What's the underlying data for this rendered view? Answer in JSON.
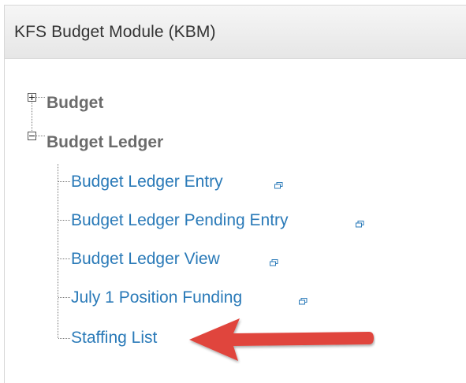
{
  "panel": {
    "title": "KFS Budget Module (KBM)"
  },
  "tree": {
    "folders": [
      {
        "label": "Budget",
        "state": "collapsed",
        "icon": "plus-expander-icon"
      },
      {
        "label": "Budget Ledger",
        "state": "expanded",
        "icon": "minus-expander-icon"
      }
    ],
    "links": [
      {
        "label": "Budget Ledger Entry",
        "external": true
      },
      {
        "label": "Budget Ledger Pending Entry",
        "external": true
      },
      {
        "label": "Budget Ledger View",
        "external": true
      },
      {
        "label": "July 1 Position Funding",
        "external": true
      },
      {
        "label": "Staffing List",
        "external": false
      }
    ]
  },
  "annotation": {
    "icon": "red-arrow-icon",
    "color": "#e0443e",
    "points_to": "Staffing List"
  },
  "colors": {
    "link": "#2a7ab8",
    "folder": "#6b6b6b",
    "header_bg": "#eeeeee"
  }
}
